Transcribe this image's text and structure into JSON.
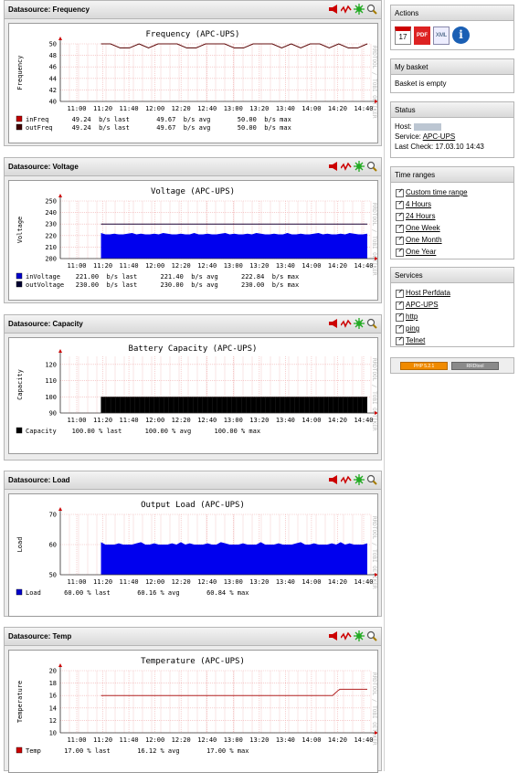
{
  "panels": [
    {
      "header": "Datasource: Frequency",
      "title": "Frequency (APC-UPS)",
      "ylabel": "Frequency",
      "yticks": [
        "50",
        "48",
        "46",
        "44",
        "42",
        "40"
      ],
      "xticks": [
        "11:00",
        "11:20",
        "11:40",
        "12:00",
        "12:20",
        "12:40",
        "13:00",
        "13:20",
        "13:40",
        "14:00",
        "14:20",
        "14:40"
      ],
      "side_label": "RRDTOOL / TOBI OETIKER",
      "legend": [
        {
          "name": "inFreq",
          "color": "#c00000",
          "text": "inFreq      49.24  b/s last       49.67  b/s avg       50.00  b/s max"
        },
        {
          "name": "outFreq",
          "color": "#400000",
          "text": "outFreq     49.24  b/s last       49.67  b/s avg       50.00  b/s max"
        }
      ]
    },
    {
      "header": "Datasource: Voltage",
      "title": "Voltage (APC-UPS)",
      "ylabel": "Voltage",
      "yticks": [
        "250",
        "240",
        "230",
        "220",
        "210",
        "200"
      ],
      "xticks": [
        "11:00",
        "11:20",
        "11:40",
        "12:00",
        "12:20",
        "12:40",
        "13:00",
        "13:20",
        "13:40",
        "14:00",
        "14:20",
        "14:40"
      ],
      "side_label": "RRDTOOL / TOBI OETIKER",
      "legend": [
        {
          "name": "inVoltage",
          "color": "#0000cc",
          "text": "inVoltage    221.00  b/s last      221.40  b/s avg      222.84  b/s max"
        },
        {
          "name": "outVoltage",
          "color": "#000033",
          "text": "outVoltage   230.00  b/s last      230.00  b/s avg      230.00  b/s max"
        }
      ]
    },
    {
      "header": "Datasource: Capacity",
      "title": "Battery Capacity (APC-UPS)",
      "ylabel": "Capacity",
      "yticks": [
        "120",
        "110",
        "100",
        "90"
      ],
      "xticks": [
        "11:00",
        "11:20",
        "11:40",
        "12:00",
        "12:20",
        "12:40",
        "13:00",
        "13:20",
        "13:40",
        "14:00",
        "14:20",
        "14:40"
      ],
      "side_label": "RRDTOOL / TOBI OETIKER",
      "legend": [
        {
          "name": "Capacity",
          "color": "#000000",
          "text": "Capacity    100.00 % last      100.00 % avg      100.00 % max"
        }
      ]
    },
    {
      "header": "Datasource: Load",
      "title": "Output Load (APC-UPS)",
      "ylabel": "Load",
      "yticks": [
        "70",
        "60",
        "50"
      ],
      "xticks": [
        "11:00",
        "11:20",
        "11:40",
        "12:00",
        "12:20",
        "12:40",
        "13:00",
        "13:20",
        "13:40",
        "14:00",
        "14:20",
        "14:40"
      ],
      "side_label": "RRDTOOL / TOBI OETIKER",
      "legend": [
        {
          "name": "Load",
          "color": "#0000cc",
          "text": "Load      60.00 % last       60.16 % avg       60.84 % max"
        }
      ]
    },
    {
      "header": "Datasource: Temp",
      "title": "Temperature (APC-UPS)",
      "ylabel": "Temperature",
      "yticks": [
        "20",
        "18",
        "16",
        "14",
        "12",
        "10"
      ],
      "xticks": [
        "11:00",
        "11:20",
        "11:40",
        "12:00",
        "12:20",
        "12:40",
        "13:00",
        "13:20",
        "13:40",
        "14:00",
        "14:20",
        "14:40"
      ],
      "side_label": "RRDTOOL / TOBI OETIKER",
      "legend": [
        {
          "name": "Temp",
          "color": "#cc0000",
          "text": "Temp      17.00 % last       16.12 % avg       17.00 % max"
        }
      ]
    }
  ],
  "chart_data": [
    {
      "type": "line",
      "title": "Frequency (APC-UPS)",
      "ylabel": "Frequency",
      "ylim": [
        40,
        50
      ],
      "x": [
        "11:00",
        "11:20",
        "11:40",
        "12:00",
        "12:20",
        "12:40",
        "13:00",
        "13:20",
        "13:40",
        "14:00",
        "14:20",
        "14:40"
      ],
      "series": [
        {
          "name": "inFreq",
          "values": [
            null,
            50,
            49.5,
            49.6,
            50,
            49.6,
            49.5,
            49.8,
            49.7,
            49.6,
            49.5,
            49.24
          ]
        },
        {
          "name": "outFreq",
          "values": [
            null,
            50,
            49.5,
            49.6,
            50,
            49.6,
            49.5,
            49.8,
            49.7,
            49.6,
            49.5,
            49.24
          ]
        }
      ]
    },
    {
      "type": "area",
      "title": "Voltage (APC-UPS)",
      "ylabel": "Voltage",
      "ylim": [
        200,
        250
      ],
      "x": [
        "11:00",
        "11:20",
        "11:40",
        "12:00",
        "12:20",
        "12:40",
        "13:00",
        "13:20",
        "13:40",
        "14:00",
        "14:20",
        "14:40"
      ],
      "series": [
        {
          "name": "inVoltage",
          "values": [
            null,
            221,
            221.5,
            221.8,
            222,
            222.2,
            221.5,
            221,
            221.2,
            221.6,
            221.4,
            221
          ]
        },
        {
          "name": "outVoltage",
          "values": [
            null,
            230,
            230,
            230,
            230,
            230,
            230,
            230,
            230,
            230,
            230,
            230
          ]
        }
      ]
    },
    {
      "type": "area",
      "title": "Battery Capacity (APC-UPS)",
      "ylabel": "Capacity",
      "ylim": [
        90,
        125
      ],
      "x": [
        "11:00",
        "11:20",
        "11:40",
        "12:00",
        "12:20",
        "12:40",
        "13:00",
        "13:20",
        "13:40",
        "14:00",
        "14:20",
        "14:40"
      ],
      "series": [
        {
          "name": "Capacity",
          "values": [
            null,
            100,
            100,
            100,
            100,
            100,
            100,
            100,
            100,
            100,
            100,
            100
          ]
        }
      ]
    },
    {
      "type": "area",
      "title": "Output Load (APC-UPS)",
      "ylabel": "Load",
      "ylim": [
        50,
        70
      ],
      "x": [
        "11:00",
        "11:20",
        "11:40",
        "12:00",
        "12:20",
        "12:40",
        "13:00",
        "13:20",
        "13:40",
        "14:00",
        "14:20",
        "14:40"
      ],
      "series": [
        {
          "name": "Load",
          "values": [
            null,
            60,
            60.2,
            60,
            60.4,
            60.2,
            60,
            60.3,
            60.1,
            60.2,
            60.1,
            60
          ]
        }
      ]
    },
    {
      "type": "line",
      "title": "Temperature (APC-UPS)",
      "ylabel": "Temperature",
      "ylim": [
        10,
        20
      ],
      "x": [
        "11:00",
        "11:20",
        "11:40",
        "12:00",
        "12:20",
        "12:40",
        "13:00",
        "13:20",
        "13:40",
        "14:00",
        "14:20",
        "14:40"
      ],
      "series": [
        {
          "name": "Temp",
          "values": [
            null,
            16,
            16,
            16,
            16,
            16,
            16,
            16,
            16,
            16,
            16,
            17
          ]
        }
      ]
    }
  ],
  "sidebar": {
    "actions": {
      "title": "Actions"
    },
    "basket": {
      "title": "My basket",
      "text": "Basket is empty"
    },
    "status": {
      "title": "Status",
      "host_label": "Host:",
      "service_label": "Service:",
      "service_value": "APC-UPS",
      "check_label": "Last Check:",
      "check_value": "17.03.10 14:43"
    },
    "time_ranges": {
      "title": "Time ranges",
      "items": [
        "Custom time range",
        "4 Hours",
        "24 Hours",
        "One Week",
        "One Month",
        "One Year"
      ]
    },
    "services": {
      "title": "Services",
      "items": [
        "Host Perfdata",
        "APC-UPS",
        "http",
        "ping",
        "Telnet"
      ]
    },
    "badges": [
      "PHP 5.2.1",
      "RRDtool"
    ]
  },
  "colors": {
    "grid": "#f3c1c1",
    "axis": "#333333",
    "red_line": "#8b1a1a",
    "blue": "#0000ee",
    "black": "#000000"
  }
}
